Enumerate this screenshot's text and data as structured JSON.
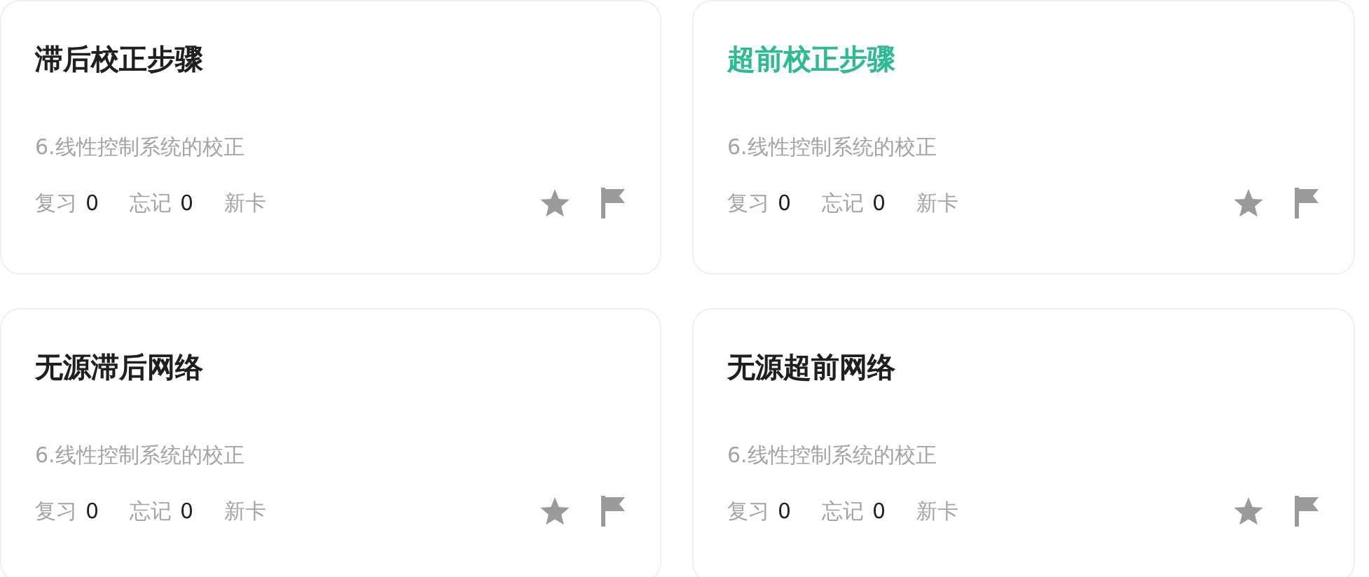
{
  "cards": [
    {
      "title": "滞后校正步骤",
      "selected": false,
      "subject": "6.线性控制系统的校正",
      "stats": [
        {
          "label": "复习",
          "count": "0"
        },
        {
          "label": "忘记",
          "count": "0"
        },
        {
          "label": "新卡"
        }
      ]
    },
    {
      "title": "超前校正步骤",
      "selected": true,
      "subject": "6.线性控制系统的校正",
      "stats": [
        {
          "label": "复习",
          "count": "0"
        },
        {
          "label": "忘记",
          "count": "0"
        },
        {
          "label": "新卡"
        }
      ]
    },
    {
      "title": "无源滞后网络",
      "selected": false,
      "subject": "6.线性控制系统的校正",
      "stats": [
        {
          "label": "复习",
          "count": "0"
        },
        {
          "label": "忘记",
          "count": "0"
        },
        {
          "label": "新卡"
        }
      ]
    },
    {
      "title": "无源超前网络",
      "selected": false,
      "subject": "6.线性控制系统的校正",
      "stats": [
        {
          "label": "复习",
          "count": "0"
        },
        {
          "label": "忘记",
          "count": "0"
        },
        {
          "label": "新卡"
        }
      ]
    }
  ]
}
